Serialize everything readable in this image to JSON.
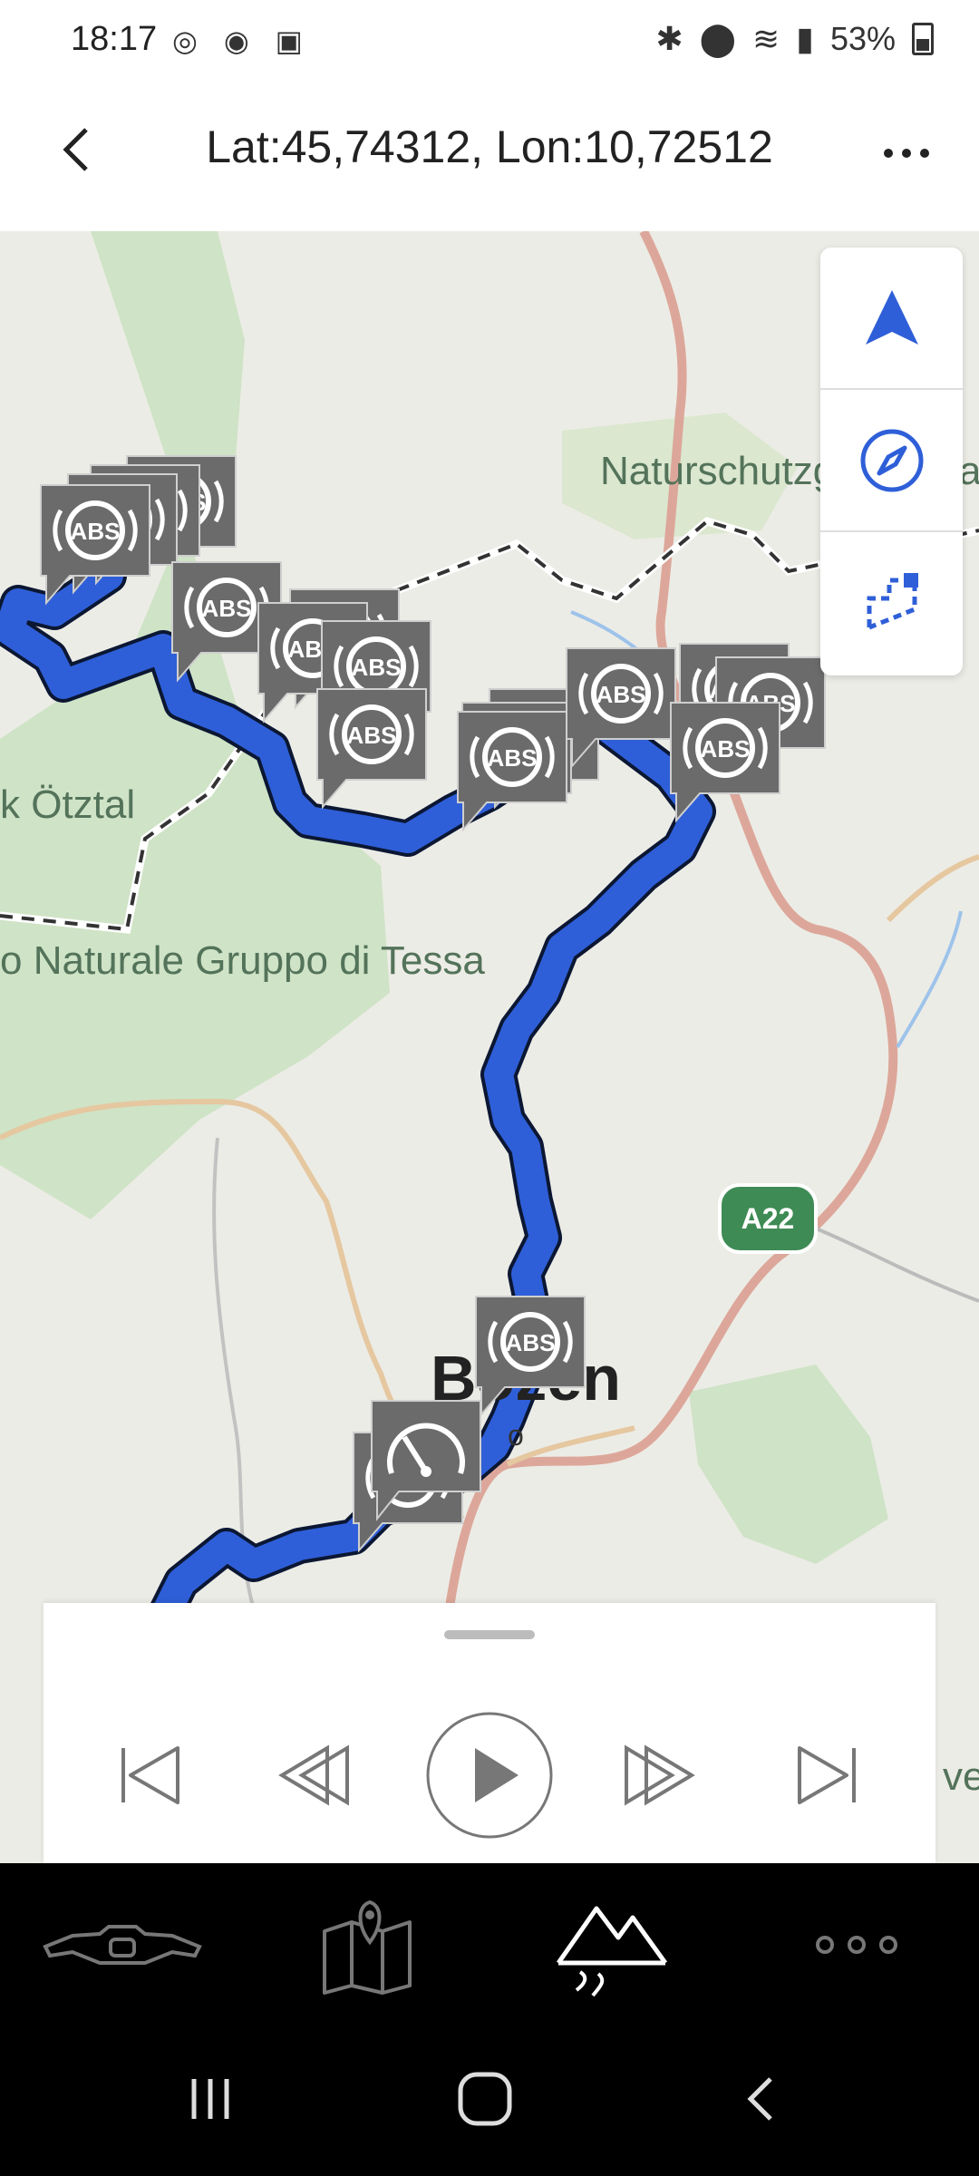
{
  "status_bar": {
    "time": "18:17",
    "battery": "53%"
  },
  "app_bar": {
    "title": "Lat:45,74312, Lon:10,72512"
  },
  "map": {
    "labels": {
      "naturschutz": "Naturschutzg",
      "naturschutz_tail": "a",
      "oetztal": "k Ötztal",
      "tessa": "o Naturale Gruppo di Tessa",
      "bolzano": "Bozen",
      "bolzano_sub": "o",
      "edge_right": "ve"
    },
    "road_badge": "A22",
    "route_color": "#2f5fd8",
    "marker_label": "ABS"
  },
  "map_controls": {
    "items": [
      "navigation-icon",
      "compass-icon",
      "region-select-icon"
    ],
    "accent": "#2f5fd8"
  },
  "player": {
    "buttons": [
      "skip-to-start",
      "rewind",
      "play",
      "fast-forward",
      "skip-to-end"
    ]
  },
  "bottom_nav": {
    "items": [
      "motorcycle-icon",
      "map-icon",
      "trips-mountain-icon",
      "more-icon"
    ],
    "active": "trips-mountain-icon"
  }
}
